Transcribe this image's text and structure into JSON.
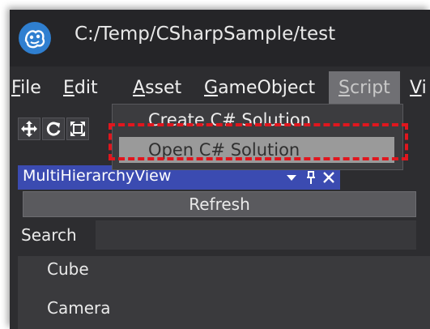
{
  "window": {
    "title": "C:/Temp/CSharpSample/test"
  },
  "menubar": {
    "items": [
      {
        "label": "File",
        "mnemonic": "F",
        "rest": "ile"
      },
      {
        "label": "Edit",
        "mnemonic": "E",
        "rest": "dit"
      },
      {
        "label": "Asset",
        "mnemonic": "A",
        "rest": "sset"
      },
      {
        "label": "GameObject",
        "mnemonic": "G",
        "rest": "ameObject"
      },
      {
        "label": "Script",
        "mnemonic": "S",
        "rest": "cript"
      },
      {
        "label": "Vi",
        "mnemonic": "V",
        "rest": "i"
      }
    ]
  },
  "toolbar": {
    "icons": [
      "move-icon",
      "rotate-icon",
      "scale-icon"
    ]
  },
  "dropdown": {
    "items": [
      "Create C# Solution",
      "Open C# Solution"
    ],
    "highlighted": "Open C# Solution"
  },
  "panel": {
    "tab_label": "MultiHierarchyView",
    "refresh_label": "Refresh",
    "search_label": "Search",
    "search_value": "",
    "tree_items": [
      "Cube",
      "Camera"
    ]
  },
  "colors": {
    "annotation": "#e0161e",
    "tab_accent": "#3b4bb1"
  }
}
